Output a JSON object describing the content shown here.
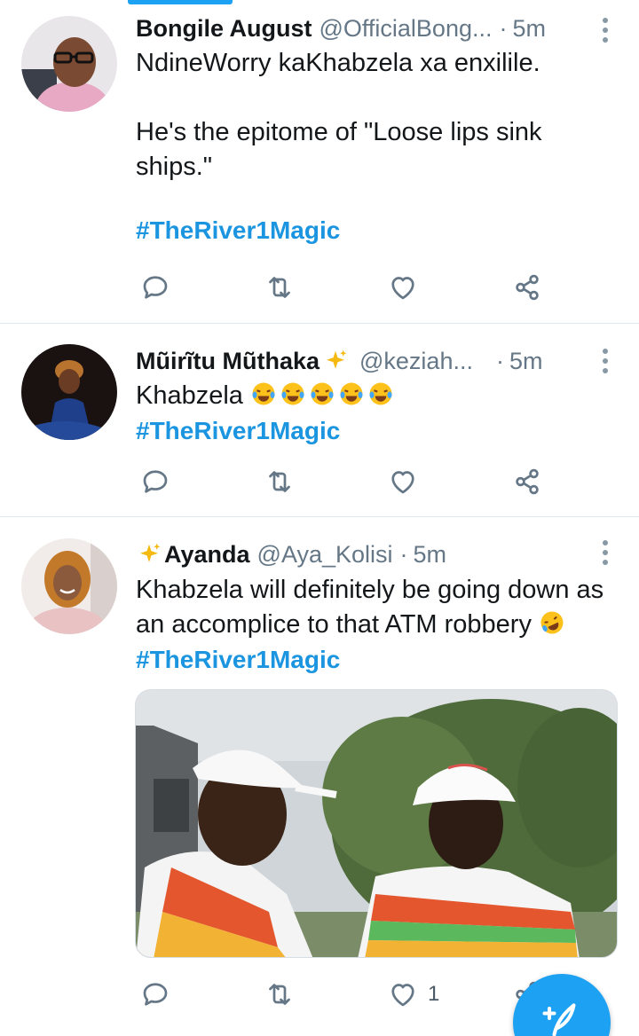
{
  "tweets": [
    {
      "name": "Bongile August",
      "handle": "@OfficialBong...",
      "separator": "·",
      "time": "5m",
      "body_line1": "NdineWorry kaKhabzela xa enxilile.",
      "body_line2": "He's the epitome of \"Loose lips sink ships.\"",
      "hashtag": "#TheRiver1Magic"
    },
    {
      "name": "Mũirĩtu Mũthaka",
      "handle": "@keziah...",
      "separator": "·",
      "time": "5m",
      "body_text": "Khabzela",
      "hashtag": "#TheRiver1Magic"
    },
    {
      "name": "Ayanda",
      "handle": "@Aya_Kolisi",
      "separator": "·",
      "time": "5m",
      "body_text": "Khabzela will definitely be going down as an accomplice to that ATM robbery",
      "hashtag": "#TheRiver1Magic",
      "like_count": "1"
    }
  ],
  "icons": {
    "reply": "reply-icon",
    "retweet": "retweet-icon",
    "like": "heart-icon",
    "share": "share-icon",
    "more": "more-vertical-icon",
    "compose": "compose-tweet-icon"
  },
  "colors": {
    "accent": "#1da1f2",
    "hashtag": "#1b95e0",
    "muted": "#657786"
  }
}
